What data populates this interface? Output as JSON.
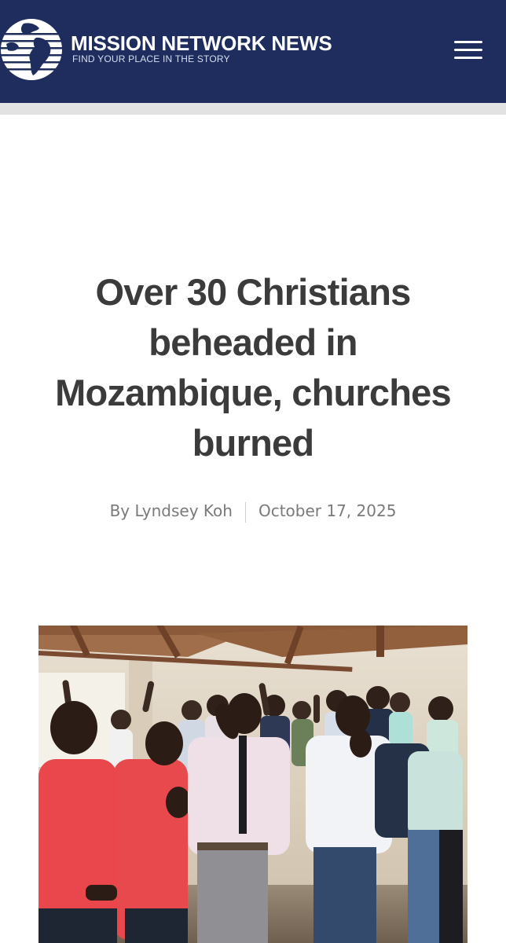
{
  "header": {
    "brand_name": "MISSION NETWORK NEWS",
    "tagline": "FIND YOUR PLACE IN THE STORY",
    "logo_icon": "globe-logo-icon",
    "menu_icon": "hamburger-menu-icon",
    "background_color": "#1e2d5e"
  },
  "article": {
    "title": "Over 30 Christians beheaded in Mozambique, churches burned",
    "author": "By Lyndsey Koh",
    "date": "October 17, 2025",
    "title_color": "#3b3b3b"
  },
  "hero_image": {
    "subject": "people praying indoors under a wooden-beam roof"
  }
}
